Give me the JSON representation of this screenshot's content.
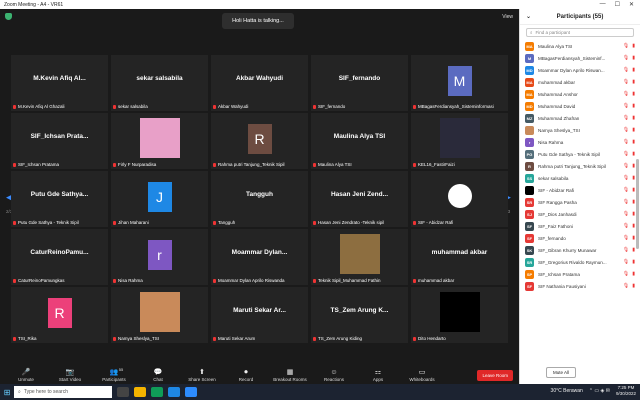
{
  "window": {
    "title": "Zoom Meeting - A4 - VR61",
    "view": "View"
  },
  "talking": "Holi Hatta is talking...",
  "nav": {
    "left_page": "2/3",
    "right_page": "2/3"
  },
  "tiles": [
    {
      "big": "M.Kevin Afiq Al...",
      "label": "M.Kevin Afiq Al Ghazali",
      "kind": "name"
    },
    {
      "big": "sekar salsabila",
      "label": "sekar salsabila",
      "kind": "name"
    },
    {
      "big": "Akbar Wahyudi",
      "label": "Akbar Wahyudi",
      "kind": "name"
    },
    {
      "big": "SIF_fernando",
      "label": "SIF_fernando",
      "kind": "name"
    },
    {
      "big": "M",
      "label": "MBagasFerdiansyah_Sisteminformasi",
      "kind": "avatar",
      "color": "#5b6bc0"
    },
    {
      "big": "SIF_Ichsan Prata...",
      "label": "SIF_Ichsan Pratama",
      "kind": "name"
    },
    {
      "big": "",
      "label": "Firly F Nurparadisa",
      "kind": "photo",
      "color": "#e8a0c8"
    },
    {
      "big": "R",
      "label": "Rahma putri Tanjung_Teknik Sipil",
      "kind": "avatar",
      "color": "#6d4c41"
    },
    {
      "big": "Maulina Alya TSI",
      "label": "Maulina Alya TSI",
      "kind": "name"
    },
    {
      "big": "",
      "label": "KEL16_FastirFaizi",
      "kind": "photo",
      "color": "#2a2a3a"
    },
    {
      "big": "Putu Gde Sathya...",
      "label": "Putu Gde Sathya - Teknik Sipil",
      "kind": "name"
    },
    {
      "big": "J",
      "label": "Jihan Maharani",
      "kind": "avatar",
      "color": "#1e88e5"
    },
    {
      "big": "Tangguh",
      "label": "Tangguh",
      "kind": "name"
    },
    {
      "big": "Hasan Jeni Zend...",
      "label": "Hasan Jeni Zendrato -Teknik sipil",
      "kind": "name"
    },
    {
      "big": "",
      "label": "SIF - Abidzar Rafi",
      "kind": "circle",
      "color": "#000"
    },
    {
      "big": "CaturReinoPamu...",
      "label": "CaturReinoPamungkas",
      "kind": "name"
    },
    {
      "big": "r",
      "label": "Nisa Rahma",
      "kind": "avatar",
      "color": "#7e57c2"
    },
    {
      "big": "Moammar Dylan...",
      "label": "Moammar Dylan Aprilo Riswanda",
      "kind": "name"
    },
    {
      "big": "",
      "label": "Teknik Sipil_Muhammad Fathin",
      "kind": "photo",
      "color": "#8d6e40"
    },
    {
      "big": "muhammad akbar",
      "label": "muhammad akbar",
      "kind": "name"
    },
    {
      "big": "R",
      "label": "TSI_Rika",
      "kind": "avatar",
      "color": "#ec407a"
    },
    {
      "big": "",
      "label": "Namya Sheslya_TSI",
      "kind": "photo",
      "color": "#c98a5a"
    },
    {
      "big": "Maruti Sekar Ar...",
      "label": "Maruti Sekar Arum",
      "kind": "name"
    },
    {
      "big": "TS_Zem Arung K...",
      "label": "TS_Zem Arung Kiding",
      "kind": "name"
    },
    {
      "big": "",
      "label": "Dito Hendarto",
      "kind": "photo",
      "color": "#000"
    }
  ],
  "toolbar": [
    {
      "icon": "🎤",
      "label": "Unmute"
    },
    {
      "icon": "📷",
      "label": "Start Video"
    },
    {
      "icon": "👥",
      "label": "Participants"
    },
    {
      "icon": "💬",
      "label": "Chat"
    },
    {
      "icon": "⬆",
      "label": "Share Screen"
    },
    {
      "icon": "⏺",
      "label": "Record"
    },
    {
      "icon": "▦",
      "label": "Breakout Rooms"
    },
    {
      "icon": "☺",
      "label": "Reactions"
    },
    {
      "icon": "⚏",
      "label": "Apps"
    },
    {
      "icon": "▭",
      "label": "Whiteboards"
    }
  ],
  "participants_count": "55",
  "leave": "Leave Room",
  "panel": {
    "title": "Participants (55)",
    "search_placeholder": "Find a participant",
    "mute_all": "Mute All"
  },
  "participants": [
    {
      "init": "MA",
      "name": "Maulina Alya TSI",
      "color": "#f57c00"
    },
    {
      "init": "M",
      "name": "MBagasFerdiansyah_Sisteminf...",
      "color": "#5b6bc0"
    },
    {
      "init": "MD",
      "name": "Moammar Dylan Aprilo Riswan...",
      "color": "#1e88e5"
    },
    {
      "init": "MA",
      "name": "muhammad akbar",
      "color": "#e64a19"
    },
    {
      "init": "MA",
      "name": "Muhammad Anshor",
      "color": "#f57c00"
    },
    {
      "init": "MD",
      "name": "Muhammad David",
      "color": "#f57c00"
    },
    {
      "init": "MZ",
      "name": "Muhammad Zhafran",
      "color": "#455a64"
    },
    {
      "init": "",
      "name": "Namya Sheslya_TSI",
      "color": "#c98a5a"
    },
    {
      "init": "r",
      "name": "Nisa Rahma",
      "color": "#7e57c2"
    },
    {
      "init": "PG",
      "name": "Putu Gde Sathya - Teknik Sipil",
      "color": "#546e7a"
    },
    {
      "init": "R",
      "name": "Rahma putri Tanjung_Teknik Sipil",
      "color": "#6d4c41"
    },
    {
      "init": "SS",
      "name": "sekar salsabila",
      "color": "#26a69a"
    },
    {
      "init": "",
      "name": "SIF - Abidzar Rafi",
      "color": "#000"
    },
    {
      "init": "SR",
      "name": "SIF Rangga Pasha",
      "color": "#e53935"
    },
    {
      "init": "SJ",
      "name": "SIF_Dios Janhasdi",
      "color": "#e53935"
    },
    {
      "init": "SF",
      "name": "SIF_Faiz Fathoni",
      "color": "#37474f"
    },
    {
      "init": "SF",
      "name": "SIF_fernando",
      "color": "#e53935"
    },
    {
      "init": "SK",
      "name": "SIF_Gibran Khurry Munawar",
      "color": "#37474f"
    },
    {
      "init": "SR",
      "name": "SIF_Gregorius Rivaldo Raymun...",
      "color": "#26a69a"
    },
    {
      "init": "SP",
      "name": "SIF_Ichsan Pratama",
      "color": "#f57c00"
    },
    {
      "init": "SF",
      "name": "SIF Nathania Fausiyani",
      "color": "#e53935"
    }
  ],
  "taskbar": {
    "search": "Type here to search",
    "weather": "30°C Berawan",
    "time": "7:25 PM",
    "date": "9/30/2022"
  }
}
